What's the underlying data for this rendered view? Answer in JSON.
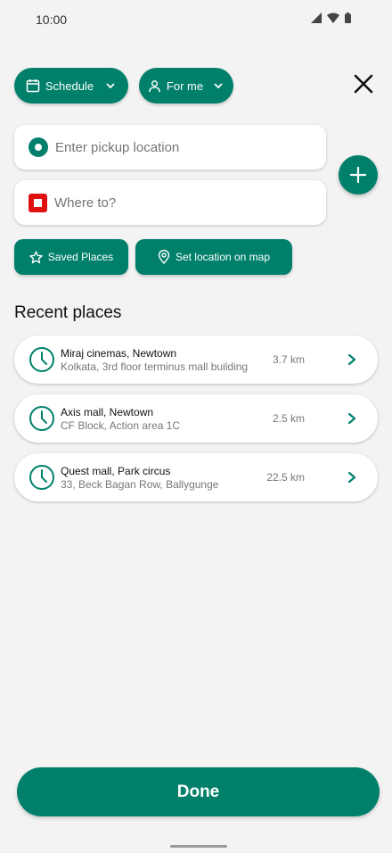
{
  "status_bar": {
    "time": "10:00"
  },
  "top_controls": {
    "schedule_label": "Schedule",
    "forme_label": "For me"
  },
  "inputs": {
    "pickup_placeholder": "Enter pickup location",
    "destination_placeholder": "Where to?"
  },
  "chips": {
    "saved_places": "Saved Places",
    "set_location": "Set location on map"
  },
  "recent": {
    "title": "Recent places",
    "items": [
      {
        "name": "Miraj cinemas, Newtown",
        "address": "Kolkata, 3rd floor terminus mall building",
        "distance": "3.7 km"
      },
      {
        "name": "Axis mall, Newtown",
        "address": "CF Block, Action area 1C",
        "distance": "2.5 km"
      },
      {
        "name": "Quest mall, Park circus",
        "address": "33, Beck Bagan Row, Ballygunge",
        "distance": "22.5 km"
      }
    ]
  },
  "done_label": "Done",
  "colors": {
    "accent": "#00806b",
    "destination": "#e01010",
    "background": "#f3f3f3"
  },
  "icons": [
    "calendar-icon",
    "chevron-down-icon",
    "person-icon",
    "close-icon",
    "plus-icon",
    "star-icon",
    "location-pin-icon",
    "clock-icon",
    "chevron-right-icon",
    "signal-icon",
    "wifi-icon",
    "battery-icon"
  ]
}
